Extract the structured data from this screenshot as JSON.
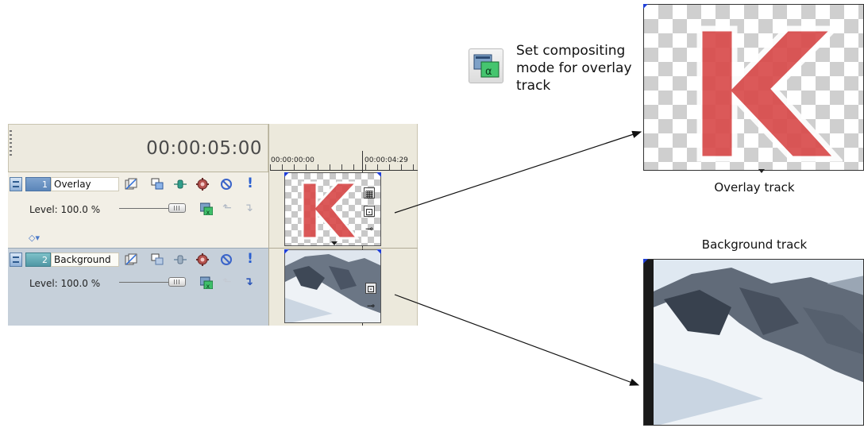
{
  "header": {
    "timecode": "00:00:05:00"
  },
  "ruler": {
    "start_label": "00:00:00:00",
    "end_label": "00:00:04:29"
  },
  "tracks": [
    {
      "number": "1",
      "name": "Overlay",
      "level": "Level: 100.0 %"
    },
    {
      "number": "2",
      "name": "Background",
      "level": "Level: 100.0 %"
    }
  ],
  "callout": {
    "text": "Set compositing mode for overlay track",
    "icon": "compositing-mode-icon"
  },
  "captions": {
    "overlay": "Overlay track",
    "background": "Background track"
  },
  "overlay_letter": "K",
  "icons": {
    "track_fx_bypass": "fx-bypass-icon",
    "track_motion": "track-motion-icon",
    "automation": "automation-icon",
    "track_fx": "track-fx-icon",
    "mute": "mute-icon",
    "solo": "solo-icon",
    "compositing": "compositing-mode-icon",
    "make_parent": "make-compositing-parent-icon",
    "make_child": "make-compositing-child-icon"
  },
  "colors": {
    "letter_red": "#d94b4b",
    "corner_marker": "#1f3fd9",
    "track1_bg": "#f2efe6",
    "track2_bg": "#c6d0da"
  }
}
